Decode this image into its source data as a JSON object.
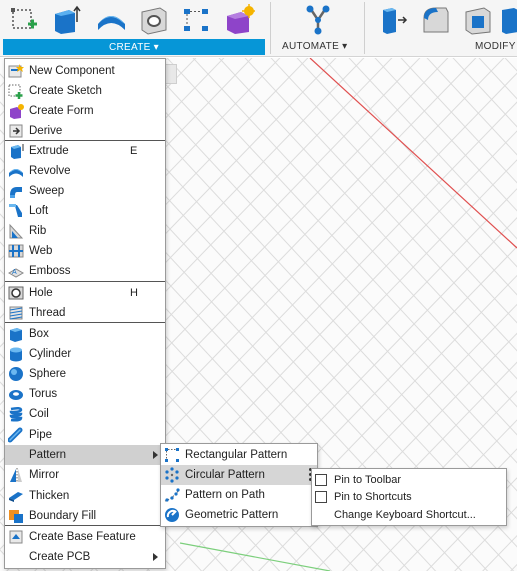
{
  "toolbar": {
    "groups": [
      {
        "label": "CREATE ▾"
      },
      {
        "label": "AUTOMATE ▾"
      },
      {
        "label": "MODIFY"
      }
    ],
    "icons": [
      "new-sketch-icon",
      "extrude-icon",
      "revolve-icon",
      "hole-icon",
      "rectangular-pattern-icon",
      "create-form-icon",
      "automate-icon",
      "press-pull-icon",
      "fillet-icon",
      "shell-icon",
      "combine-icon"
    ]
  },
  "create_menu": {
    "items": [
      {
        "label": "New Component",
        "shortcut": "",
        "icon": "new-component-icon"
      },
      {
        "label": "Create Sketch",
        "shortcut": "",
        "icon": "create-sketch-icon"
      },
      {
        "label": "Create Form",
        "shortcut": "",
        "icon": "create-form-icon"
      },
      {
        "label": "Derive",
        "shortcut": "",
        "icon": "derive-icon"
      },
      {
        "label": "Extrude",
        "shortcut": "E",
        "icon": "extrude-icon"
      },
      {
        "label": "Revolve",
        "shortcut": "",
        "icon": "revolve-icon"
      },
      {
        "label": "Sweep",
        "shortcut": "",
        "icon": "sweep-icon"
      },
      {
        "label": "Loft",
        "shortcut": "",
        "icon": "loft-icon"
      },
      {
        "label": "Rib",
        "shortcut": "",
        "icon": "rib-icon"
      },
      {
        "label": "Web",
        "shortcut": "",
        "icon": "web-icon"
      },
      {
        "label": "Emboss",
        "shortcut": "",
        "icon": "emboss-icon"
      },
      {
        "label": "Hole",
        "shortcut": "H",
        "icon": "hole-icon"
      },
      {
        "label": "Thread",
        "shortcut": "",
        "icon": "thread-icon"
      },
      {
        "label": "Box",
        "shortcut": "",
        "icon": "box-icon"
      },
      {
        "label": "Cylinder",
        "shortcut": "",
        "icon": "cylinder-icon"
      },
      {
        "label": "Sphere",
        "shortcut": "",
        "icon": "sphere-icon"
      },
      {
        "label": "Torus",
        "shortcut": "",
        "icon": "torus-icon"
      },
      {
        "label": "Coil",
        "shortcut": "",
        "icon": "coil-icon"
      },
      {
        "label": "Pipe",
        "shortcut": "",
        "icon": "pipe-icon"
      },
      {
        "label": "Pattern",
        "shortcut": "",
        "icon": "",
        "submenu": true,
        "highlighted": true
      },
      {
        "label": "Mirror",
        "shortcut": "",
        "icon": "mirror-icon"
      },
      {
        "label": "Thicken",
        "shortcut": "",
        "icon": "thicken-icon"
      },
      {
        "label": "Boundary Fill",
        "shortcut": "",
        "icon": "boundary-fill-icon"
      },
      {
        "label": "Create Base Feature",
        "shortcut": "",
        "icon": "create-base-feature-icon"
      },
      {
        "label": "Create PCB",
        "shortcut": "",
        "icon": "",
        "submenu": true
      }
    ]
  },
  "pattern_menu": {
    "items": [
      {
        "label": "Rectangular Pattern",
        "icon": "rectangular-pattern-icon"
      },
      {
        "label": "Circular Pattern",
        "icon": "circular-pattern-icon",
        "highlighted": true
      },
      {
        "label": "Pattern on Path",
        "icon": "pattern-on-path-icon"
      },
      {
        "label": "Geometric Pattern",
        "icon": "geometric-pattern-icon"
      }
    ]
  },
  "context_menu": {
    "items": [
      {
        "label": "Pin to Toolbar",
        "checkbox": true
      },
      {
        "label": "Pin to Shortcuts",
        "checkbox": true
      },
      {
        "label": "Change Keyboard Shortcut...",
        "checkbox": false
      }
    ]
  },
  "colors": {
    "accent": "#0696d7",
    "highlight": "#d0d0d0"
  }
}
